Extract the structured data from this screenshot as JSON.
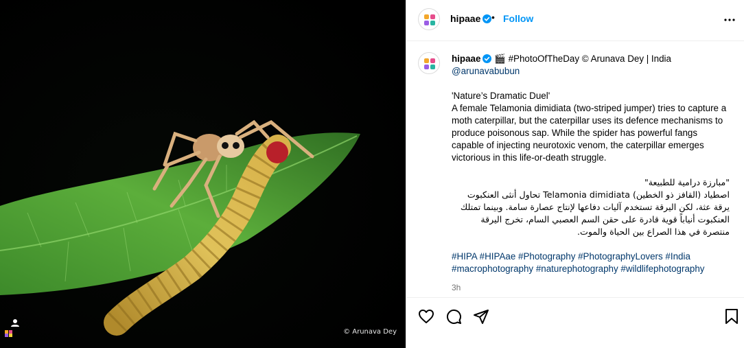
{
  "photo": {
    "credit": "© Arunava Dey",
    "alt_subject": "Jumping spider on a caterpillar on a leaf"
  },
  "header": {
    "username": "hipaae",
    "separator": "•",
    "follow_label": "Follow"
  },
  "caption": {
    "username": "hipaae",
    "clapper": "🎬",
    "intro": "#PhotoOfTheDay © Arunava Dey | India",
    "mention": "@arunavabubun",
    "title": "'Nature’s Dramatic Duel'",
    "body_en": "A female Telamonia dimidiata (two-striped jumper) tries to capture a moth caterpillar, but the caterpillar uses its defence mechanisms to produce poisonous sap. While the spider has powerful fangs capable of injecting neurotoxic venom, the caterpillar emerges victorious in this life-or-death struggle.",
    "title_ar": "\"مبارزة درامية للطبيعة\"",
    "body_ar": "اصطياد (القافز ذو الخطين) Telamonia dimidiata تحاول أنثى العنكبوت يرقة عثة، لكن اليرقة تستخدم آليات دفاعها لإنتاج عصارة سامة. وبينما تمتلك العنكبوت أنياباً قوية قادرة على حقن السم العصبي السام، تخرج اليرقة منتصرة في هذا الصراع بين الحياة والموت.",
    "hashtags_line1": "#HIPA #HIPAae #Photography #PhotographyLovers #India",
    "hashtags_line2": "#macrophotography #naturephotography #wildlifephotography",
    "time": "3h"
  },
  "actions": {
    "like_icon": "heart-icon",
    "comment_icon": "comment-icon",
    "share_icon": "share-icon",
    "save_icon": "bookmark-icon"
  },
  "colors": {
    "link": "#0095f6",
    "hashtag": "#00376b",
    "verified": "#0095f6",
    "muted": "#737373"
  }
}
